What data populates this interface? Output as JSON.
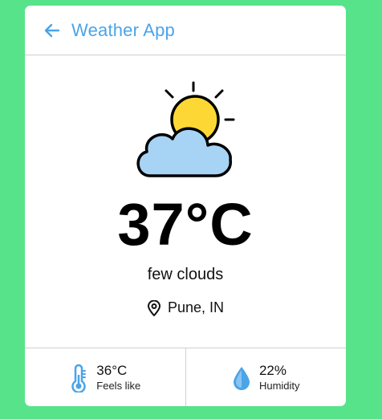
{
  "header": {
    "title": "Weather App"
  },
  "weather": {
    "temperature": "37°C",
    "description": "few clouds",
    "location": "Pune, IN",
    "icon": "partly-cloudy-icon"
  },
  "stats": {
    "feels_like": {
      "value": "36°C",
      "label": "Feels like",
      "icon": "thermometer-icon"
    },
    "humidity": {
      "value": "22%",
      "label": "Humidity",
      "icon": "droplet-icon"
    }
  },
  "colors": {
    "background": "#57e389",
    "accent": "#4aa4e8",
    "sun": "#fdd835",
    "cloud": "#a7d3f5"
  }
}
